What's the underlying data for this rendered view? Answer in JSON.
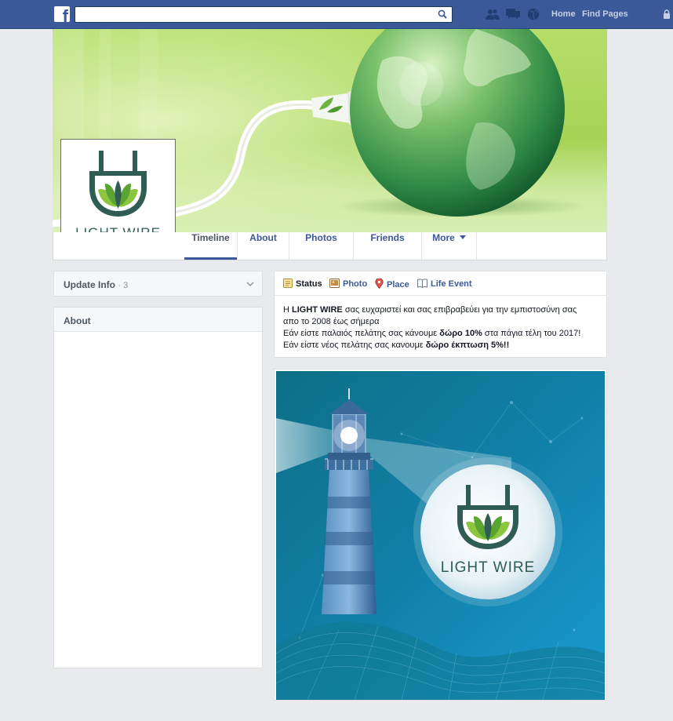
{
  "topbar": {
    "search_placeholder": "",
    "nav": {
      "home": "Home",
      "find_pages": "Find Pages"
    }
  },
  "profile": {
    "brand_name": "LIGHT WIRE"
  },
  "tabs": [
    {
      "label": "Timeline",
      "active": true
    },
    {
      "label": "About"
    },
    {
      "label": "Photos"
    },
    {
      "label": "Friends"
    },
    {
      "label": "More"
    }
  ],
  "sidebar": {
    "update_info_label": "Update Info",
    "update_info_count": "· 3",
    "about_title": "About"
  },
  "composer": {
    "tabs": {
      "status": "Status",
      "photo": "Photo",
      "place": "Place",
      "life_event": "Life Event"
    },
    "post": {
      "l1_a": "Η ",
      "l1_b": "LIGHT WIRE",
      "l1_c": " σας ευχαριστεί και σας επιβραβεύει για την εμπιστοσύνη σας",
      "l2": "απο το 2008 έως σήμερα",
      "l3_a": "Εάν είστε παλαιός πελάτης σας κάνουμε ",
      "l3_b": "δώρο 10%",
      "l3_c": " στα πάγια τέλη του 2017!",
      "l4_a": "Εάν είστε νέος πελάτης σας κανουμε ",
      "l4_b": "δώρο έκπτωση 5%!!"
    }
  },
  "post_image": {
    "brand_name": "LIGHT WIRE"
  },
  "colors": {
    "facebook_blue": "#3b5998",
    "brand_green": "#2e8b57",
    "brand_dark": "#2f5d54"
  }
}
